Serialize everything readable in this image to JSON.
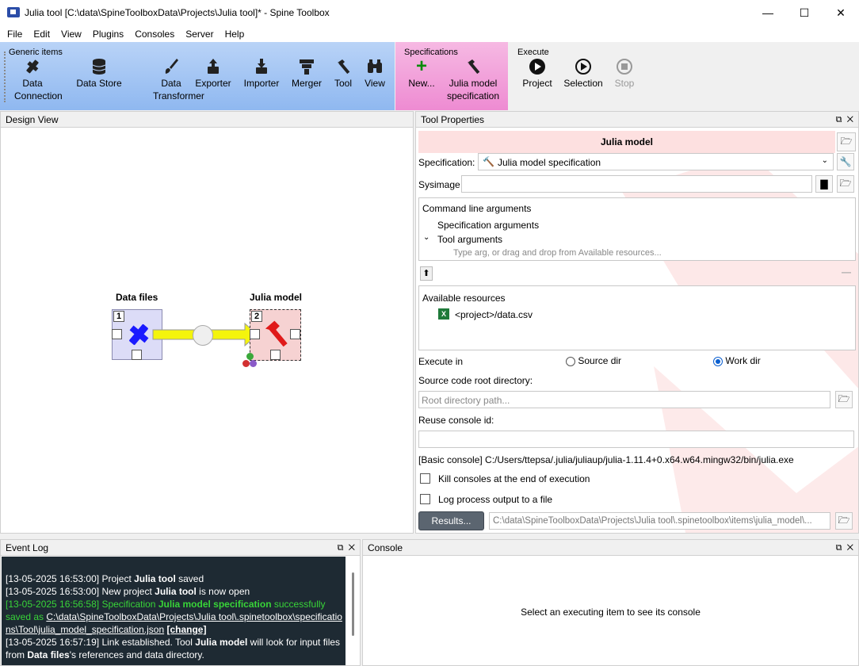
{
  "window": {
    "title": "Julia tool [C:\\data\\SpineToolboxData\\Projects\\Julia tool]* - Spine Toolbox",
    "minimize": "—",
    "maximize": "☐",
    "close": "✕"
  },
  "menu": [
    "File",
    "Edit",
    "View",
    "Plugins",
    "Consoles",
    "Server",
    "Help"
  ],
  "toolbar": {
    "generic_title": "Generic items",
    "generic": [
      {
        "label": "Data\nConnection",
        "icon": "data-connection-icon"
      },
      {
        "label": "Data Store",
        "icon": "database-icon"
      },
      {
        "label": "Data\nTransformer",
        "icon": "brush-icon"
      },
      {
        "label": "Exporter",
        "icon": "export-icon"
      },
      {
        "label": "Importer",
        "icon": "import-icon"
      },
      {
        "label": "Merger",
        "icon": "merge-icon"
      },
      {
        "label": "Tool",
        "icon": "hammer-icon"
      },
      {
        "label": "View",
        "icon": "binoculars-icon"
      }
    ],
    "spec_title": "Specifications",
    "spec": [
      {
        "label": "New...",
        "icon": "plus-icon"
      },
      {
        "label": "Julia model\nspecification",
        "icon": "hammer-icon"
      }
    ],
    "exec_title": "Execute",
    "exec": [
      {
        "label": "Project",
        "icon": "play-icon"
      },
      {
        "label": "Selection",
        "icon": "play-outline-icon"
      },
      {
        "label": "Stop",
        "icon": "stop-icon"
      }
    ]
  },
  "design": {
    "title": "Design View",
    "items": [
      {
        "name": "Data files",
        "number": "1"
      },
      {
        "name": "Julia model",
        "number": "2"
      }
    ]
  },
  "props": {
    "title": "Tool Properties",
    "item_name": "Julia model",
    "specification_label": "Specification:",
    "specification_value": "Julia model specification",
    "sysimage_label": "Sysimage",
    "cmd_header": "Command line arguments",
    "spec_args": "Specification arguments",
    "tool_args": "Tool arguments",
    "args_placeholder": "Type arg, or drag and drop from Available resources...",
    "available_header": "Available resources",
    "resource": "<project>/data.csv",
    "execute_in_label": "Execute in",
    "source_dir": "Source dir",
    "work_dir": "Work dir",
    "execute_in_selected": "Work dir",
    "source_root_label": "Source code root directory:",
    "source_root_placeholder": "Root directory path...",
    "reuse_label": "Reuse console id:",
    "console_info": "[Basic console] C:/Users/ttepsa/.julia/juliaup/julia-1.11.4+0.x64.w64.mingw32/bin/julia.exe",
    "kill_label": "Kill consoles at the end of execution",
    "log_label": "Log process output to a file",
    "results_label": "Results...",
    "results_path": "C:\\data\\SpineToolboxData\\Projects\\Julia tool\\.spinetoolbox\\items\\julia_model\\..."
  },
  "eventlog": {
    "title": "Event Log",
    "lines": [
      {
        "ts": "[13-05-2025 16:53:00] ",
        "pre": "Project ",
        "b": "Julia tool",
        "post": " saved"
      },
      {
        "ts": "[13-05-2025 16:53:00] ",
        "pre": "New project ",
        "b": "Julia tool",
        "post": " is now open"
      },
      {
        "ts": "[13-05-2025 16:56:58] ",
        "pre": "Specification ",
        "b": "Julia model specification",
        "post": " successfully saved as ",
        "link": "C:\\data\\SpineToolboxData\\Projects\\Julia tool\\.spinetoolbox\\specifications\\Tool\\julia_model_specification.json",
        "change": "[change]"
      },
      {
        "ts": "[13-05-2025 16:57:19] ",
        "pre": "Link established. Tool ",
        "b": "Julia model",
        "post": " will look for input files from ",
        "b2": "Data files",
        "post2": "'s references and data directory."
      }
    ]
  },
  "console": {
    "title": "Console",
    "message": "Select an executing item to see its console"
  },
  "colors": {
    "generic_bg": "#9fc2f3",
    "spec_bg": "#f29fd9",
    "accent": "#0b5fd0",
    "log_bg": "#1e2a33",
    "log_green": "#38d438"
  }
}
